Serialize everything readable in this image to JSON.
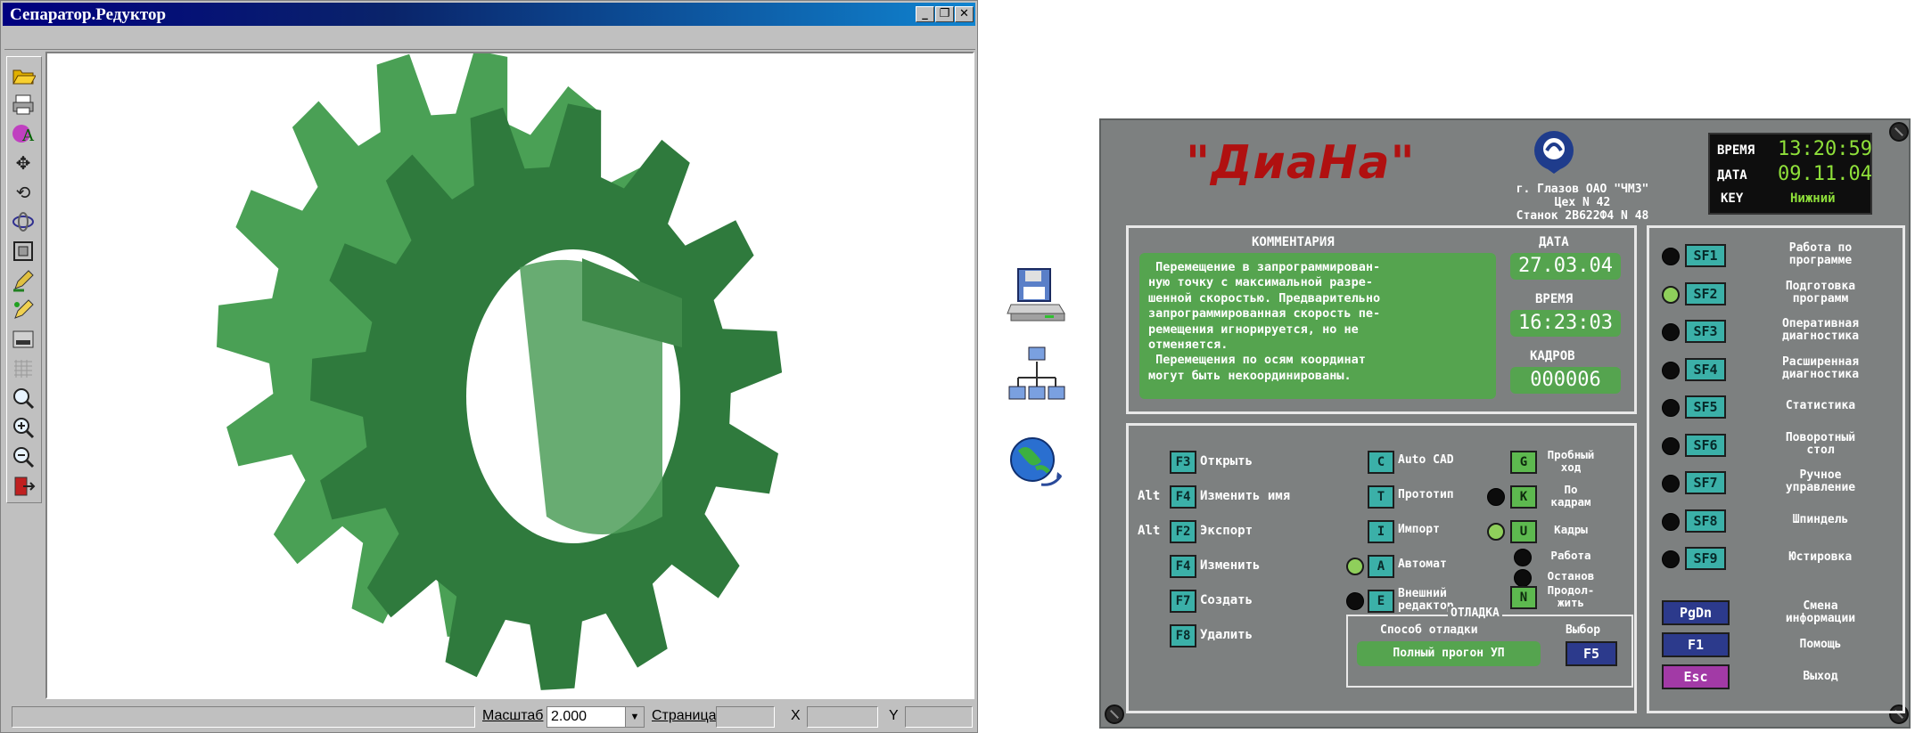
{
  "cad_window": {
    "title": "Сепаратор.Редуктор",
    "window_buttons": [
      "_",
      "❐",
      "✕"
    ],
    "status": {
      "scale_label": "Масштаб",
      "scale_value": "2.000",
      "page_label": "Страница",
      "x_label": "X",
      "y_label": "Y"
    },
    "toolbar_icons": [
      "open-folder-icon",
      "print-icon",
      "text-style-icon",
      "move-icon",
      "rotate-icon",
      "orbit-icon",
      "frame-icon",
      "pencil-icon",
      "edit-icon",
      "screen-icon",
      "grid-icon",
      "zoom-icon",
      "zoom-in-icon",
      "zoom-out-icon",
      "exit-icon"
    ]
  },
  "middle_icons": [
    "floppy-drive-icon",
    "network-icon",
    "globe-icon"
  ],
  "diana": {
    "logo": "\"ДиаНа\"",
    "company": [
      "г. Глазов ОАО \"ЧМЗ\"",
      "Цех N 42",
      "Станок 2В622Ф4 N 48"
    ],
    "clock": {
      "time_label": "ВРЕМЯ",
      "time_value": "13:20:59",
      "date_label": "ДАТА",
      "date_value": "09.11.04",
      "key_label": "KEY",
      "key_value": "Нижний"
    },
    "comments": {
      "header": "КОММЕНТАРИЯ",
      "lines": [
        " Перемещение в запрограммирован-",
        "ную точку с максимальной разре-",
        "шенной скоростью. Предварительно",
        "запрограммированная скорость пе-",
        "ремещения игнорируется, но не",
        "отменяется.",
        " Перемещения по осям координат",
        "могут быть некоординированы."
      ],
      "date_label": "ДАТА",
      "date_value": "27.03.04",
      "time_label": "ВРЕМЯ",
      "time_value": "16:23:03",
      "frames_label": "КАДРОВ",
      "frames_value": "000006"
    },
    "file_menu": [
      {
        "prefix": "",
        "key": "F3",
        "label": "Открыть"
      },
      {
        "prefix": "Alt",
        "key": "F4",
        "label": "Изменить имя"
      },
      {
        "prefix": "Alt",
        "key": "F2",
        "label": "Экспорт"
      },
      {
        "prefix": "",
        "key": "F4",
        "label": "Изменить"
      },
      {
        "prefix": "",
        "key": "F7",
        "label": "Создать"
      },
      {
        "prefix": "",
        "key": "F8",
        "label": "Удалить"
      }
    ],
    "tools_menu": [
      {
        "key": "C",
        "label": "Auto CAD",
        "led": "none"
      },
      {
        "key": "T",
        "label": "Прототип",
        "led": "none"
      },
      {
        "key": "I",
        "label": "Импорт",
        "led": "none"
      },
      {
        "key": "A",
        "label": "Автомат",
        "led": "on"
      },
      {
        "key": "E",
        "label": "Внешний\nредактор",
        "led": "off"
      }
    ],
    "run_menu": [
      {
        "key": "G",
        "label": "Пробный\nход",
        "led": "none"
      },
      {
        "key": "K",
        "label": "По\nкадрам",
        "led": "off"
      },
      {
        "key": "U",
        "label": "Кадры",
        "led": "on"
      },
      {
        "key": "",
        "label": "Работа",
        "led": "off"
      },
      {
        "key": "",
        "label": "Останов",
        "led": "off"
      },
      {
        "key": "N",
        "label": "Продол-\nжить",
        "led": "none"
      }
    ],
    "debug": {
      "title": "ОТЛАДКА",
      "method_label": "Способ отладки",
      "method_value": "Полный прогон УП",
      "choice_label": "Выбор",
      "choice_key": "F5"
    },
    "sf_menu": [
      {
        "key": "SF1",
        "label": "Работа по\nпрограмме",
        "led": "off"
      },
      {
        "key": "SF2",
        "label": "Подготовка\nпрограмм",
        "led": "on"
      },
      {
        "key": "SF3",
        "label": "Оперативная\nдиагностика",
        "led": "off"
      },
      {
        "key": "SF4",
        "label": "Расширенная\nдиагностика",
        "led": "off"
      },
      {
        "key": "SF5",
        "label": "Статистика",
        "led": "off"
      },
      {
        "key": "SF6",
        "label": "Поворотный\nстол",
        "led": "off"
      },
      {
        "key": "SF7",
        "label": "Ручное\nуправление",
        "led": "off"
      },
      {
        "key": "SF8",
        "label": "Шпиндель",
        "led": "off"
      },
      {
        "key": "SF9",
        "label": "Юстировка",
        "led": "off"
      }
    ],
    "bottom_keys": [
      {
        "key": "PgDn",
        "label": "Смена\nинформации",
        "color": "#2c3a8c"
      },
      {
        "key": "F1",
        "label": "Помощь",
        "color": "#2c3a8c"
      },
      {
        "key": "Esc",
        "label": "Выход",
        "color": "#a23aa6"
      }
    ],
    "colors": {
      "panel": "#7d8080",
      "lcd_green": "#55a44f",
      "teal_key": "#3bb0a8",
      "logo_red": "#b01010"
    }
  }
}
